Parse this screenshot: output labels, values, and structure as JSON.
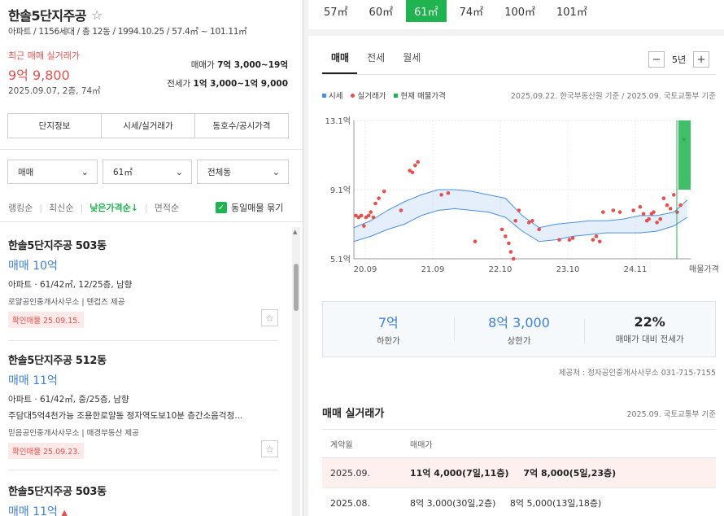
{
  "complex": {
    "name": "한솔5단지주공",
    "info": "아파트 / 1156세대 / 총 12동 / 1994.10.25 / 57.4㎡ ~ 101.11㎡",
    "recent_label": "최근 매매 실거래가",
    "recent_price": "9억 9,800",
    "recent_date": "2025.09.07, 2층, 74㎡",
    "sale_range_label": "매매가",
    "sale_range": "7억 3,000~19억",
    "jeonse_range_label": "전세가",
    "jeonse_range": "1억 3,000~1억 9,000"
  },
  "buttons": [
    "단지정보",
    "시세/실거래가",
    "동호수/공시가격"
  ],
  "filters": {
    "deal": "매매",
    "area": "61㎡",
    "dong": "전체동"
  },
  "sort": {
    "options": [
      "랭킹순",
      "최신순",
      "낮은가격순↓",
      "면적순"
    ],
    "active_index": 2,
    "group_label": "동일매물 묶기",
    "group_checked": true
  },
  "listings": [
    {
      "name": "한솔5단지주공 503동",
      "price": "매매 10억",
      "spec": "아파트 · 61/42㎡, 12/25층, 남향",
      "desc": "",
      "agent": "로얄공인중개사사무소 | 텐컵즈 제공",
      "badge": "확인매물 25.09.15."
    },
    {
      "name": "한솔5단지주공 512동",
      "price": "매매 11억",
      "spec": "아파트 · 61/42㎡, 중/25층, 남향",
      "desc": "주담대5억4천가능 조용한로얄동 정자역도보10분 층간소음걱정...",
      "agent": "믿음공인중개사사무소 | 매경부동산 제공",
      "badge": "확인매물 25.09.23."
    },
    {
      "name": "한솔5단지주공 503동",
      "price": "매매 11억",
      "spec": "",
      "desc": "",
      "agent": "",
      "badge": ""
    }
  ],
  "area_tabs": [
    "57㎡",
    "60㎡",
    "61㎡",
    "74㎡",
    "100㎡",
    "101㎡"
  ],
  "area_active_index": 2,
  "deal_tabs": [
    "매매",
    "전세",
    "월세"
  ],
  "deal_active_index": 0,
  "period": {
    "label": "5년",
    "minus": "−",
    "plus": "+"
  },
  "legend": [
    {
      "label": "시세",
      "color": "#4a90e2",
      "shape": "square"
    },
    {
      "label": "실거래가",
      "color": "#e5504e",
      "shape": "dot"
    },
    {
      "label": "현재 매물가격",
      "color": "#1fb44f",
      "shape": "square"
    }
  ],
  "chart_source": "2025.09.22. 한국부동산원 기준 / 2025.09. 국토교통부 기준",
  "chart_data": {
    "type": "line",
    "title": "",
    "x_ticks": [
      "20.09",
      "21.09",
      "22.10",
      "23.10",
      "24.11",
      "매물가격"
    ],
    "y_ticks": [
      "13.1억",
      "9.1억",
      "5.1억"
    ],
    "ylim": [
      5.1,
      13.1
    ],
    "xlim": [
      2020.75,
      2025.75
    ],
    "grid": true,
    "series": [
      {
        "name": "시세",
        "type": "band",
        "color": "#4a90e2",
        "x": [
          2020.75,
          2021.0,
          2021.25,
          2021.5,
          2021.75,
          2022.0,
          2022.25,
          2022.5,
          2022.75,
          2023.0,
          2023.25,
          2023.5,
          2023.75,
          2024.0,
          2024.25,
          2024.5,
          2024.75,
          2025.0,
          2025.25,
          2025.5,
          2025.7
        ],
        "low": [
          6.1,
          6.4,
          6.8,
          7.1,
          7.6,
          7.9,
          8.0,
          7.9,
          7.8,
          7.5,
          6.7,
          6.1,
          6.2,
          6.4,
          6.5,
          6.6,
          6.6,
          6.6,
          6.7,
          7.0,
          7.5
        ],
        "high": [
          6.9,
          7.3,
          7.9,
          8.4,
          8.8,
          9.1,
          9.1,
          9.0,
          8.8,
          8.6,
          7.6,
          6.9,
          7.1,
          7.2,
          7.3,
          7.3,
          7.4,
          7.6,
          7.6,
          7.8,
          8.5
        ]
      },
      {
        "name": "실거래가",
        "type": "scatter",
        "color": "#e5504e",
        "x": [
          2020.78,
          2020.82,
          2020.86,
          2020.9,
          2020.93,
          2020.97,
          2021.0,
          2021.04,
          2021.07,
          2021.12,
          2021.2,
          2021.45,
          2021.58,
          2021.62,
          2021.66,
          2021.7,
          2022.05,
          2022.15,
          2022.55,
          2022.95,
          2023.0,
          2023.05,
          2023.08,
          2023.12,
          2023.15,
          2023.2,
          2023.35,
          2023.4,
          2023.5,
          2023.8,
          2023.95,
          2024.0,
          2024.3,
          2024.35,
          2024.4,
          2024.45,
          2024.6,
          2024.7,
          2024.9,
          2025.0,
          2025.05,
          2025.1,
          2025.13,
          2025.17,
          2025.2,
          2025.25,
          2025.3,
          2025.35,
          2025.4,
          2025.45,
          2025.5,
          2025.55,
          2025.6,
          2025.65
        ],
        "y": [
          7.6,
          7.5,
          7.6,
          7.0,
          7.5,
          7.6,
          7.8,
          7.5,
          8.3,
          8.6,
          9.0,
          7.9,
          10.2,
          10.1,
          10.5,
          10.7,
          8.8,
          8.9,
          6.1,
          6.8,
          6.4,
          6.0,
          5.5,
          5.1,
          7.3,
          7.9,
          7.2,
          7.3,
          6.8,
          6.2,
          6.2,
          6.3,
          6.2,
          6.4,
          6.1,
          7.8,
          7.9,
          7.8,
          7.9,
          8.1,
          7.7,
          7.3,
          7.4,
          7.7,
          7.8,
          7.2,
          7.4,
          8.6,
          8.2,
          8.0,
          8.8,
          7.8,
          8.2,
          12.0
        ]
      },
      {
        "name": "현재 매물가격",
        "type": "range",
        "color": "#1fb44f",
        "low": 9.1,
        "high": 13.1
      }
    ]
  },
  "summary": {
    "low_price": "7억",
    "low_label": "하한가",
    "high_price": "8억 3,000",
    "high_label": "상한가",
    "ratio": "22%",
    "ratio_label": "매매가 대비 전세가"
  },
  "provider": "제공처 : 정자공인중개사사무소 031-715-7155",
  "deals": {
    "title": "매매 실거래가",
    "source": "2025.09. 국토교통부 기준",
    "headers": [
      "계약월",
      "매매가"
    ],
    "rows": [
      {
        "month": "2025.09.",
        "prices": [
          "11억 4,000(7일,11층)",
          "7억 8,000(5일,23층)"
        ],
        "highlight": true
      },
      {
        "month": "2025.08.",
        "prices": [
          "8억 3,000(30일,2층)",
          "8억 5,000(13일,18층)"
        ],
        "highlight": false
      }
    ]
  }
}
